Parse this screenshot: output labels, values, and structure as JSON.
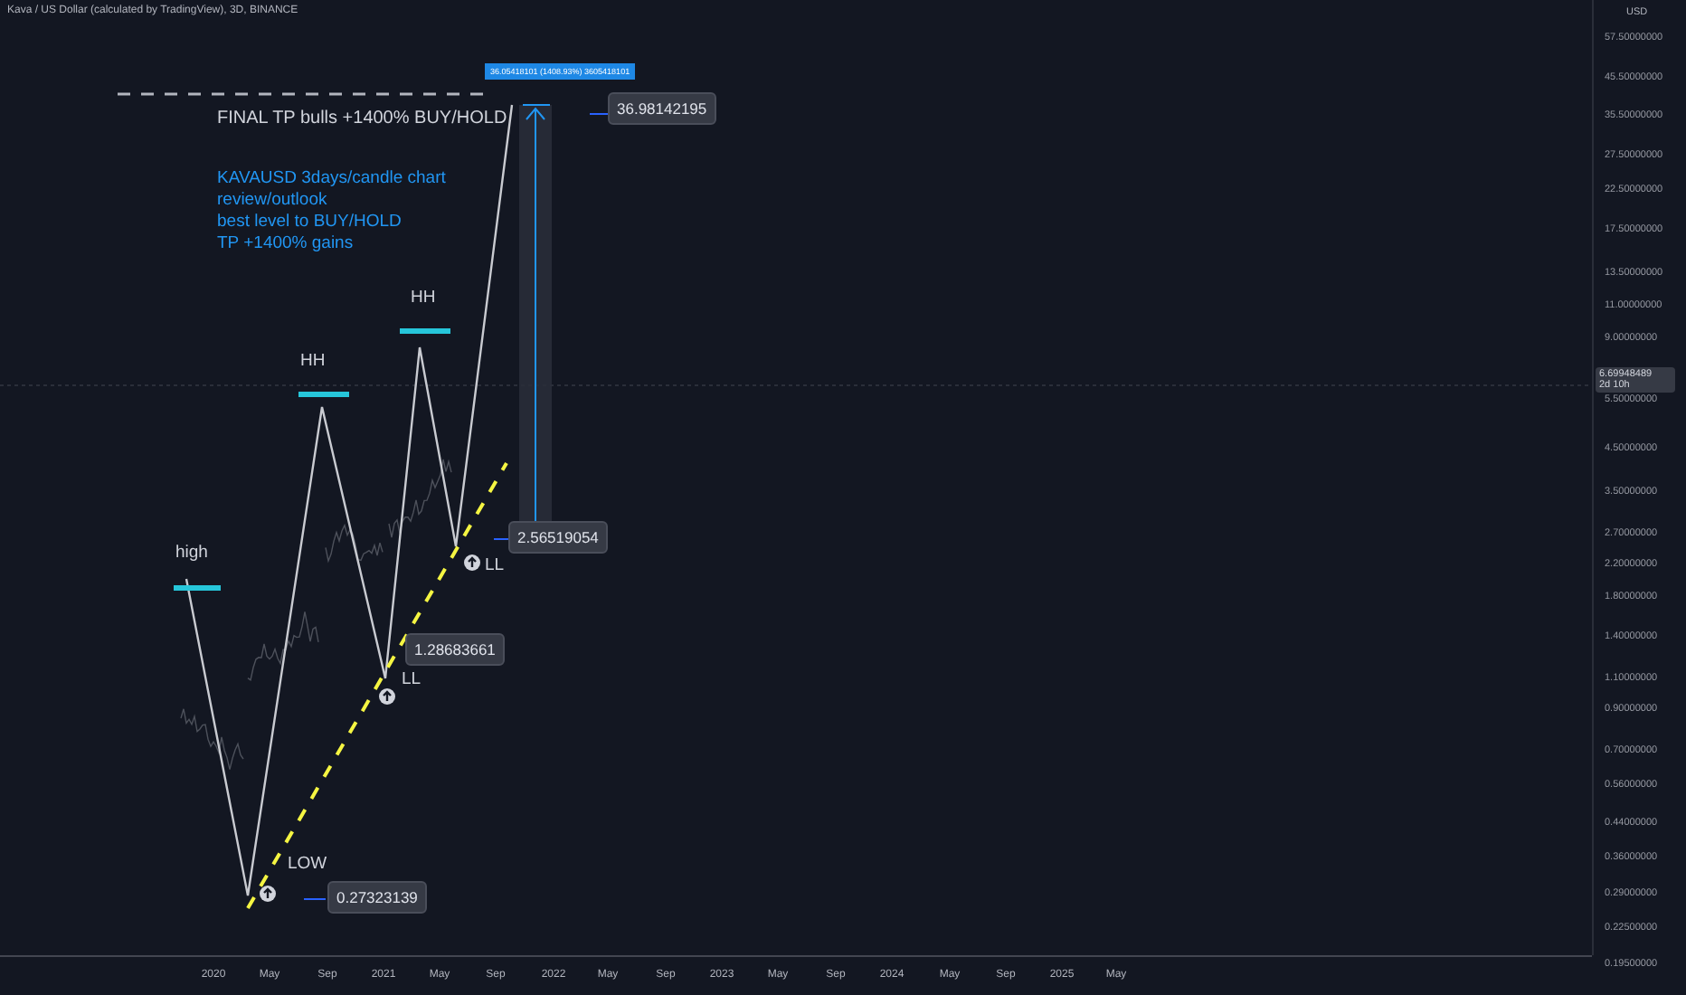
{
  "header": {
    "title": "Kava / US Dollar (calculated by TradingView), 3D, BINANCE"
  },
  "price_axis": {
    "currency": "USD",
    "labels": [
      "57.50000000",
      "45.50000000",
      "35.50000000",
      "27.50000000",
      "22.50000000",
      "17.50000000",
      "13.50000000",
      "11.00000000",
      "9.00000000",
      "5.50000000",
      "4.50000000",
      "3.50000000",
      "2.70000000",
      "2.20000000",
      "1.80000000",
      "1.40000000",
      "1.10000000",
      "0.90000000",
      "0.70000000",
      "0.56000000",
      "0.44000000",
      "0.36000000",
      "0.29000000",
      "0.22500000",
      "0.19500000"
    ],
    "current_price": "6.69948489",
    "countdown": "2d 10h"
  },
  "time_axis": {
    "labels": [
      "2020",
      "May",
      "Sep",
      "2021",
      "May",
      "Sep",
      "2022",
      "May",
      "Sep",
      "2023",
      "May",
      "Sep",
      "2024",
      "May",
      "Sep",
      "2025",
      "May"
    ]
  },
  "annotations": [
    {
      "kind": "note",
      "text": "FINAL TP bulls +1400% BUY/HOLD"
    },
    {
      "kind": "blue-note",
      "text": "KAVAUSD 3days/candle chart\nreview/outlook\nbest level to BUY/HOLD\nTP +1400% gains"
    },
    {
      "kind": "label",
      "text": "high"
    },
    {
      "kind": "label",
      "text": "HH"
    },
    {
      "kind": "label",
      "text": "HH"
    },
    {
      "kind": "label",
      "text": "LOW"
    },
    {
      "kind": "label",
      "text": "LL"
    },
    {
      "kind": "label",
      "text": "LL"
    },
    {
      "kind": "price",
      "text": "0.27323139"
    },
    {
      "kind": "price",
      "text": "1.28683661"
    },
    {
      "kind": "price",
      "text": "2.56519054"
    },
    {
      "kind": "price",
      "text": "36.98142195"
    },
    {
      "kind": "measure",
      "text": "36.05418101 (1408.93%) 3605418101"
    }
  ]
}
